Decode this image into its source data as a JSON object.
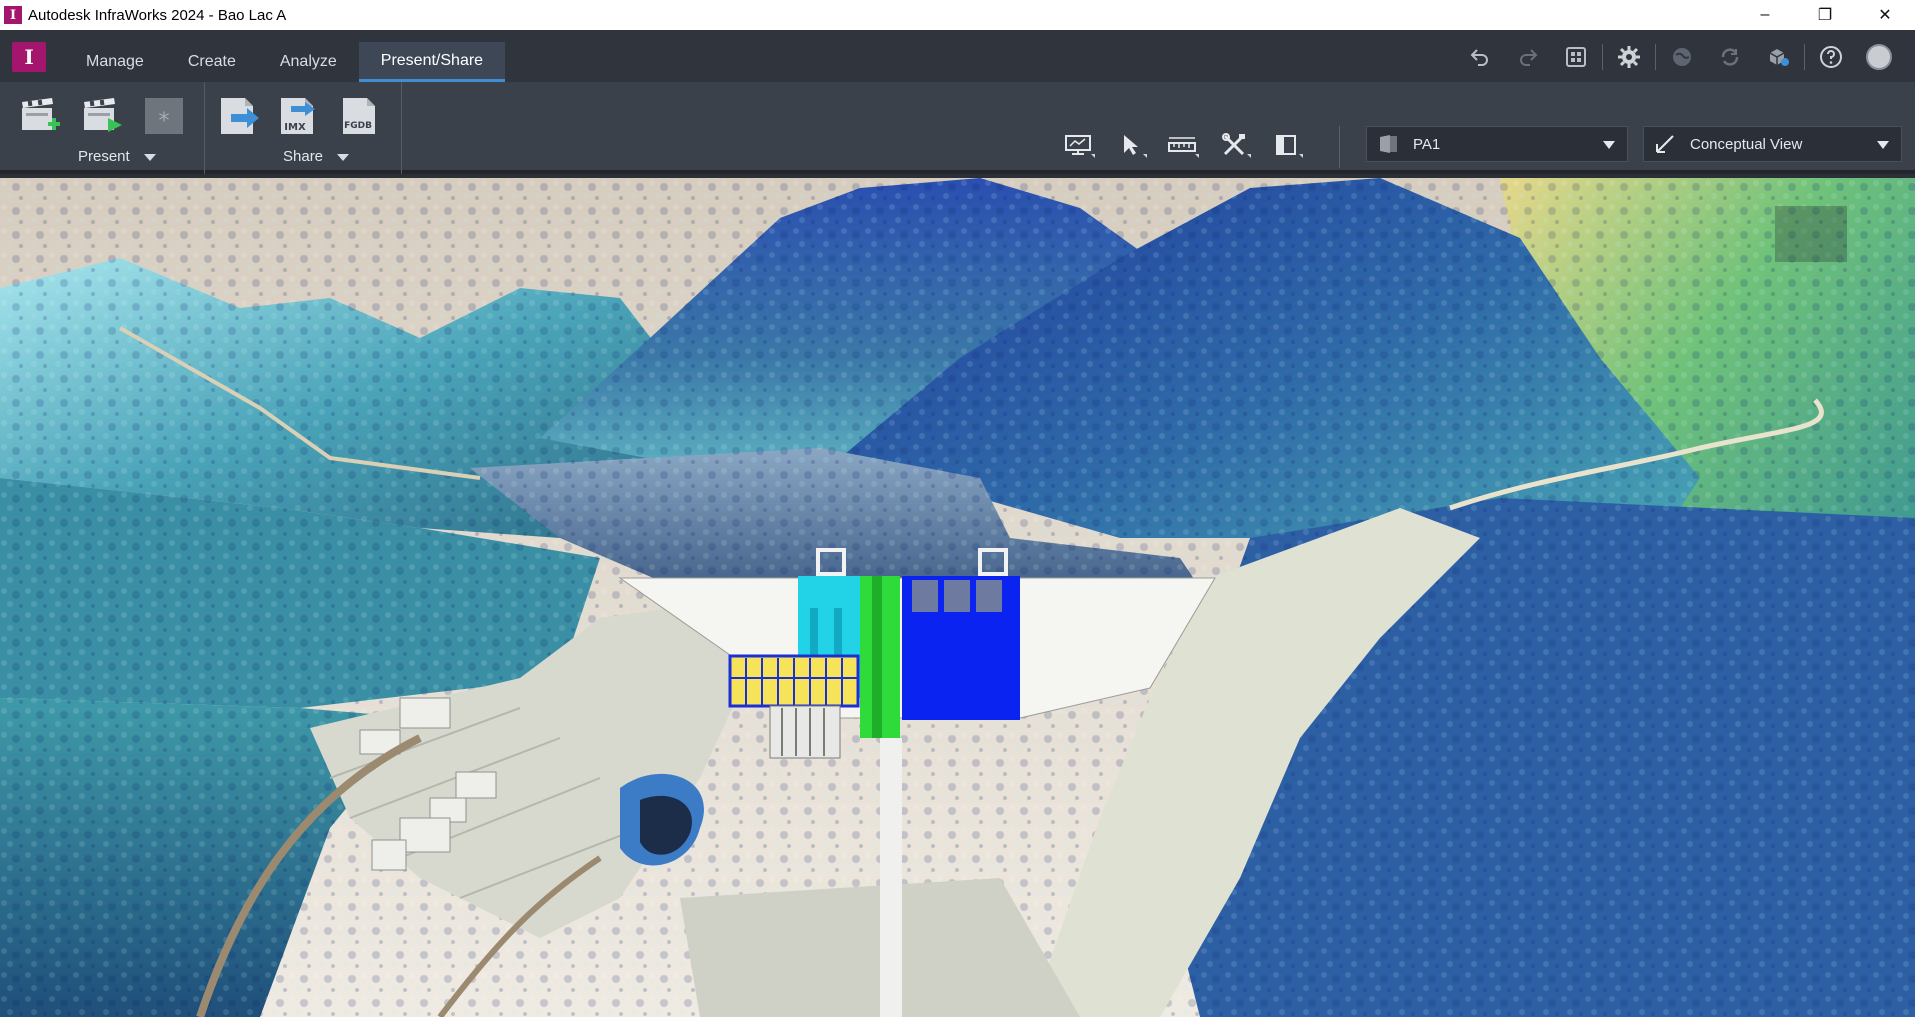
{
  "window": {
    "title": "Autodesk InfraWorks 2024 - Bao Lac A",
    "minimize_glyph": "–",
    "maximize_glyph": "❐",
    "close_glyph": "✕"
  },
  "app_logo_letter": "I",
  "tabs": [
    {
      "label": "Manage"
    },
    {
      "label": "Create"
    },
    {
      "label": "Analyze"
    },
    {
      "label": "Present/Share"
    }
  ],
  "active_tab": "Present/Share",
  "ribbon": {
    "present_label": "Present",
    "share_label": "Share",
    "imx_text": "IMX",
    "fgdb_text": "FGDB"
  },
  "proposal_dropdown": {
    "value": "PA1"
  },
  "view_dropdown": {
    "value": "Conceptual View"
  },
  "colors": {
    "accent_tab": "#3f8fd6",
    "app_brand": "#a4166e"
  }
}
